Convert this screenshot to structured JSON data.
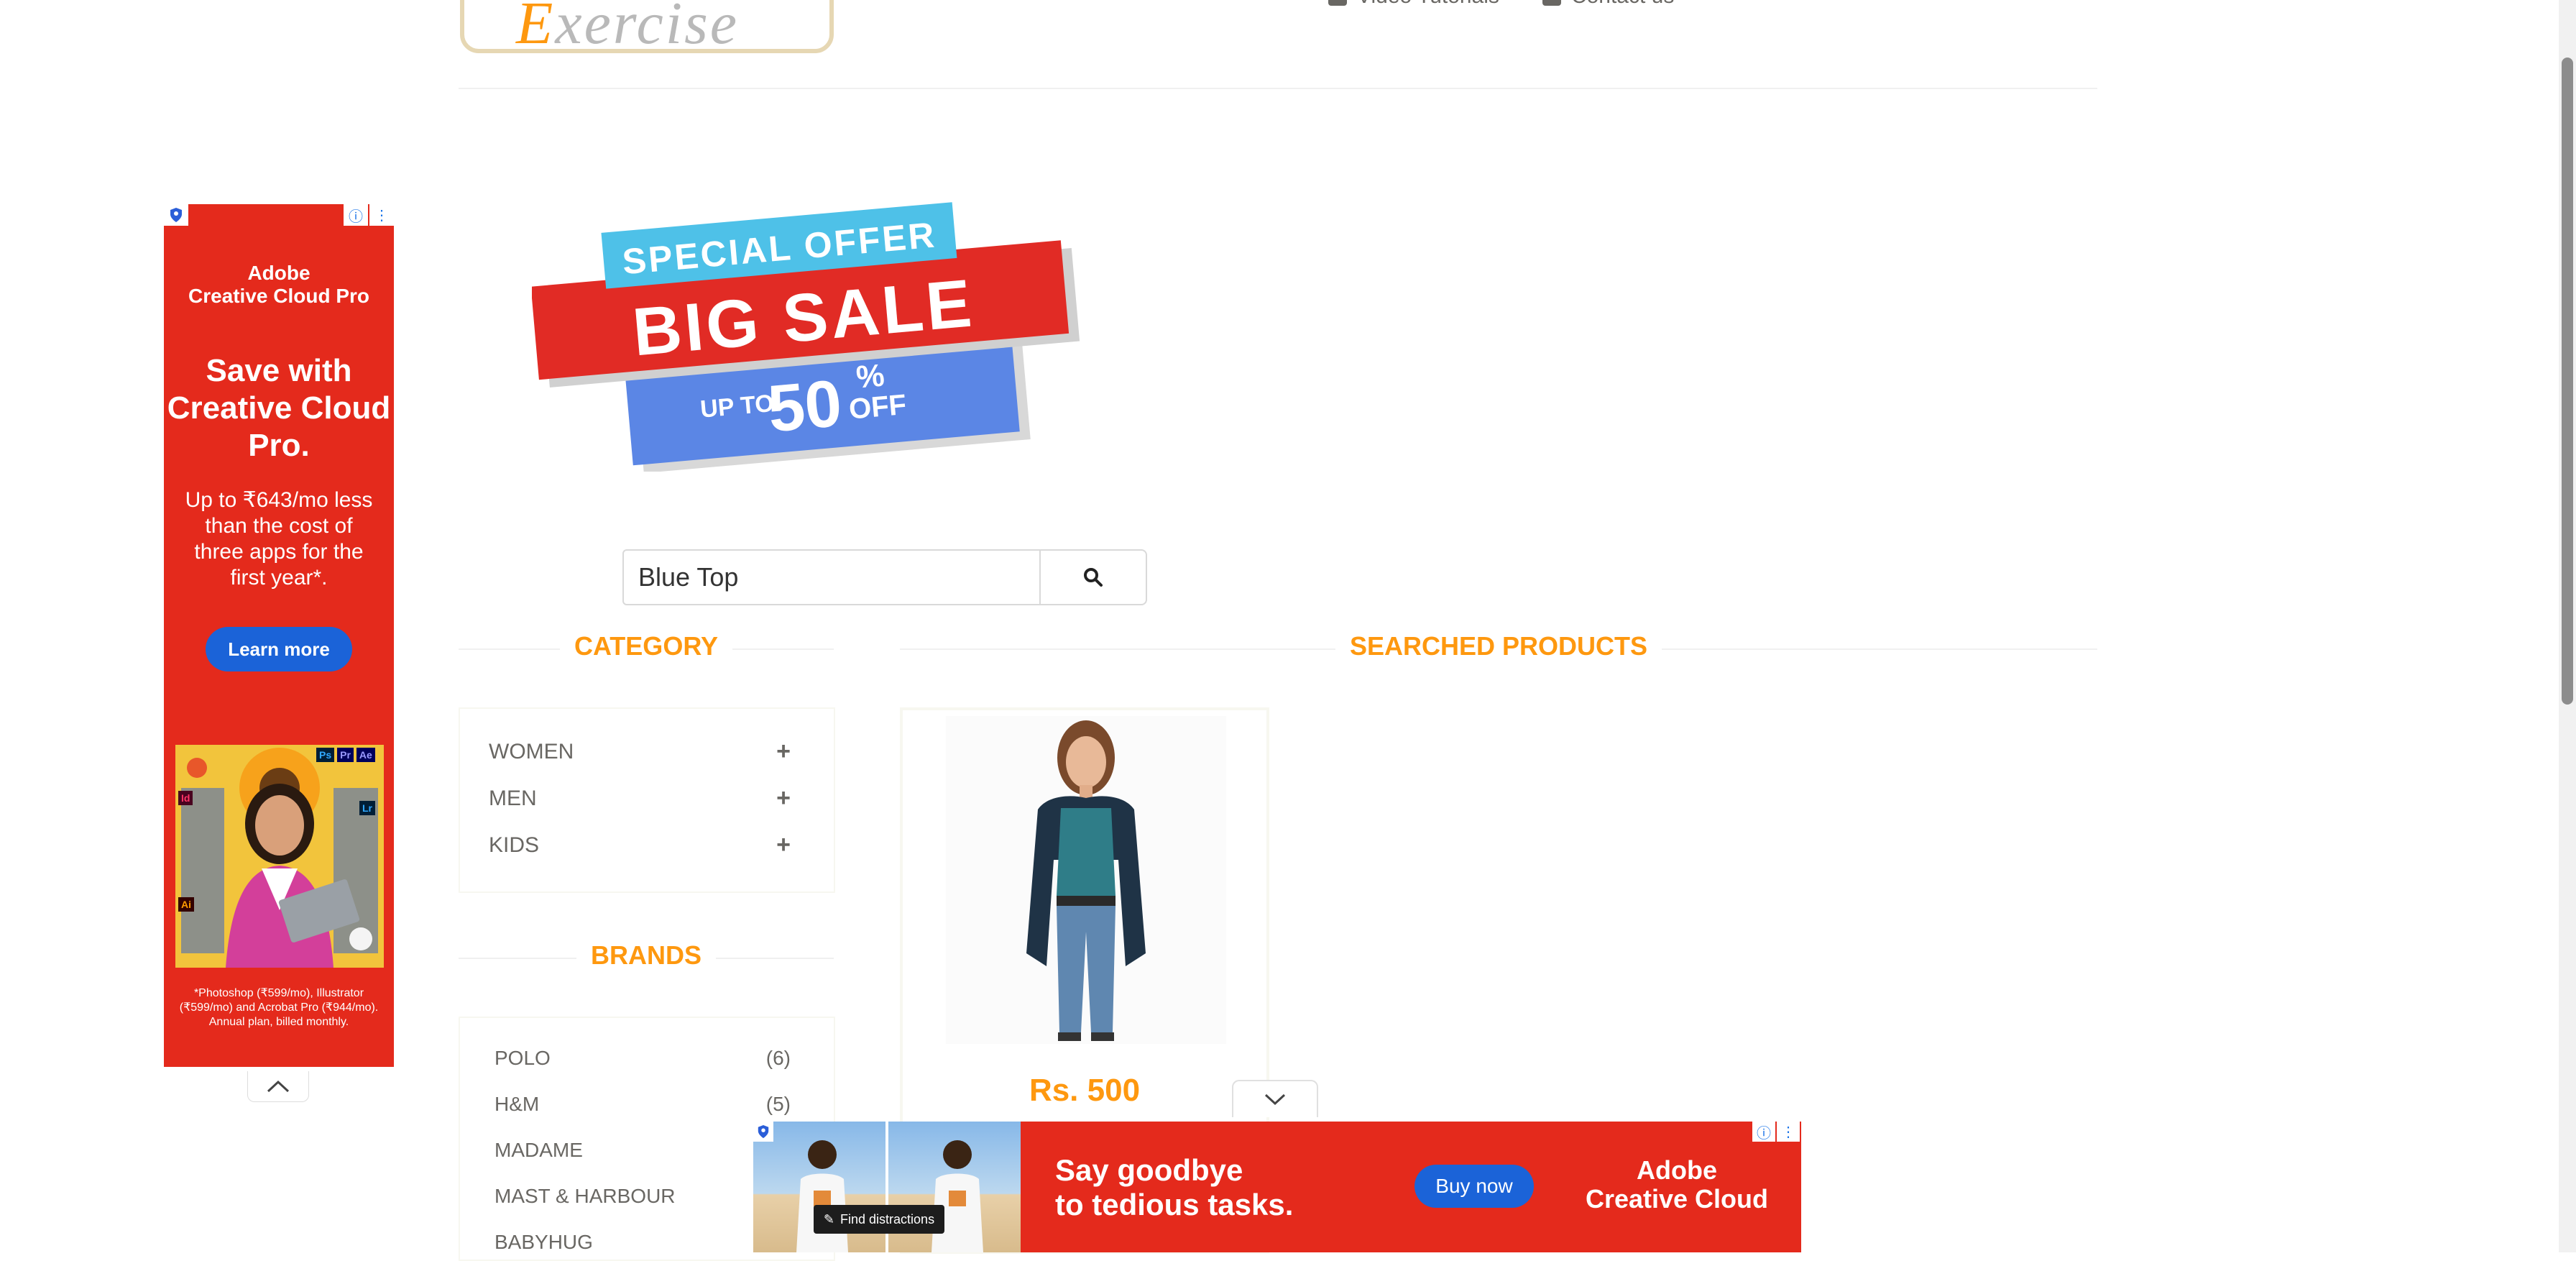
{
  "header": {
    "logo_first": "E",
    "logo_rest": "xercise",
    "links": [
      "Video Tutorials",
      "Contact us"
    ]
  },
  "side_ad": {
    "brand_line1": "Adobe",
    "brand_line2": "Creative Cloud Pro",
    "headline": "Save with Creative Cloud Pro.",
    "body": "Up to ₹643/mo less than the cost of three apps for the first year*.",
    "cta": "Learn more",
    "fine_print": "*Photoshop (₹599/mo), Illustrator (₹599/mo) and Acrobat Pro (₹944/mo). Annual plan, billed monthly.",
    "app_badges": [
      "Ps",
      "Pr",
      "Ae",
      "Id",
      "Lr",
      "Ai"
    ]
  },
  "banner": {
    "line1": "SPECIAL OFFER",
    "line2": "BIG SALE",
    "up_to": "UP TO",
    "percent": "50",
    "pct_sign": "%",
    "off": "OFF"
  },
  "search": {
    "value": "Blue Top",
    "button_icon": "search-icon"
  },
  "category": {
    "title": "Category",
    "items": [
      {
        "label": "Women",
        "icon": "+"
      },
      {
        "label": "Men",
        "icon": "+"
      },
      {
        "label": "Kids",
        "icon": "+"
      }
    ]
  },
  "brands": {
    "title": "Brands",
    "items": [
      {
        "name": "Polo",
        "count": "(6)"
      },
      {
        "name": "H&M",
        "count": "(5)"
      },
      {
        "name": "Madame",
        "count": ""
      },
      {
        "name": "Mast & Harbour",
        "count": ""
      },
      {
        "name": "Babyhug",
        "count": ""
      }
    ]
  },
  "searched": {
    "title": "Searched Products",
    "products": [
      {
        "price": "Rs. 500"
      }
    ]
  },
  "bottom_ad": {
    "find_label": "Find distractions",
    "headline_line1": "Say goodbye",
    "headline_line2": "to tedious tasks.",
    "cta": "Buy now",
    "brand_line1": "Adobe",
    "brand_line2": "Creative Cloud"
  },
  "colors": {
    "accent": "#fe980f",
    "ad_red": "#e42a1c",
    "ad_blue": "#1b63d8"
  }
}
